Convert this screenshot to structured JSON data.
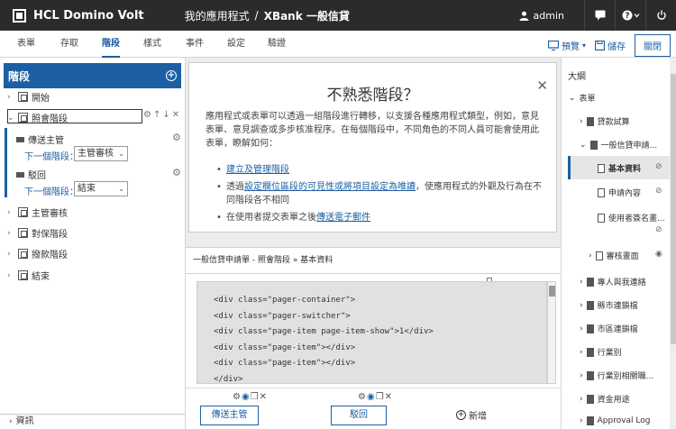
{
  "header": {
    "brand": "HCL Domino Volt",
    "app_crumb": "我的應用程式",
    "separator": "/",
    "current_app": "XBank 一般信貸",
    "user": "admin"
  },
  "tabs": [
    "表單",
    "存取",
    "階段",
    "樣式",
    "事件",
    "設定",
    "驗證"
  ],
  "active_tab": "階段",
  "actions": {
    "preview": "預覽",
    "save": "儲存",
    "close": "關閉"
  },
  "left": {
    "title": "階段",
    "stages": [
      "開始",
      "照會階段",
      "主管審核",
      "對保階段",
      "撥款階段",
      "結束"
    ],
    "selected_stage": "照會階段",
    "routes": [
      {
        "label": "傳送主管",
        "next_label": "下一個階段：",
        "next_value": "主管審核"
      },
      {
        "label": "駁回",
        "next_label": "下一個階段：",
        "next_value": "結束"
      }
    ],
    "info": "資訊"
  },
  "help": {
    "title": "不熟悉階段？",
    "desc": "應用程式或表單可以透過一組階段進行轉移，以支援各種應用程式類型，例如，意見表單、意見調查或多步核准程序。在每個階段中，不同角色的不同人員可能會使用此表單，瞭解如何：",
    "item1_link": "建立及管理階段",
    "item2_pre": "透過",
    "item2_link": "設定欄位區段的可見性或將項目設定為唯讀",
    "item2_post": "，使應用程式的外觀及行為在不同階段各不相同",
    "item3_pre": "在使用者提交表單之後",
    "item3_link": "傳送電子郵件"
  },
  "path": "一般信貸申請單 - 照會階段 » 基本資料",
  "code_lines": [
    "<div class=\"pager-container\">",
    "<div class=\"pager-switcher\">",
    "<div class=\"page-item page-item-show\">1</div>",
    "<div class=\"page-item\"></div>",
    "<div class=\"page-item\"></div>",
    "</div>"
  ],
  "route_buttons": {
    "send": "傳送主管",
    "reject": "駁回",
    "add": "新增"
  },
  "outline": {
    "title": "大綱",
    "items": [
      "表單",
      "貸款試算",
      "一般信貸申請...",
      "基本資料",
      "申請內容",
      "使用者簽名畫...",
      "審核畫面",
      "專人與我連絡",
      "縣市連鎖檔",
      "市區連鎖檔",
      "行業別",
      "行業別相關職...",
      "資金用途",
      "Approval Log"
    ]
  }
}
